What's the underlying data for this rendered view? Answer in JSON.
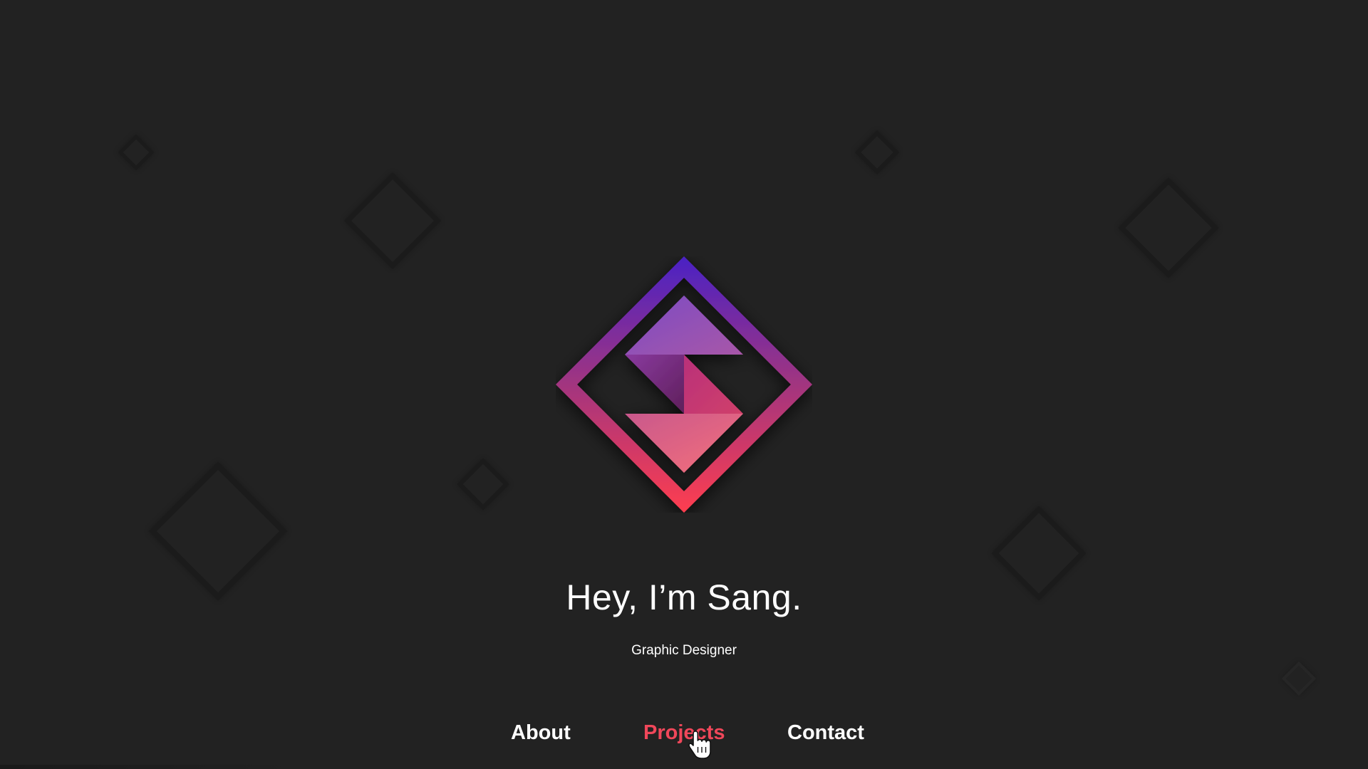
{
  "hero": {
    "headline": "Hey, I’m Sang.",
    "subtitle": "Graphic Designer"
  },
  "nav": {
    "about": "About",
    "projects": "Projects",
    "contact": "Contact"
  },
  "logo": {
    "icon": "diamond-s-logo-icon"
  },
  "colors": {
    "background": "#222222",
    "accent": "#f0475a",
    "gradient_top": "#4a22c4",
    "gradient_bottom": "#ff3d4f",
    "text": "#ffffff"
  },
  "state": {
    "hovered_nav_item": "Projects"
  }
}
